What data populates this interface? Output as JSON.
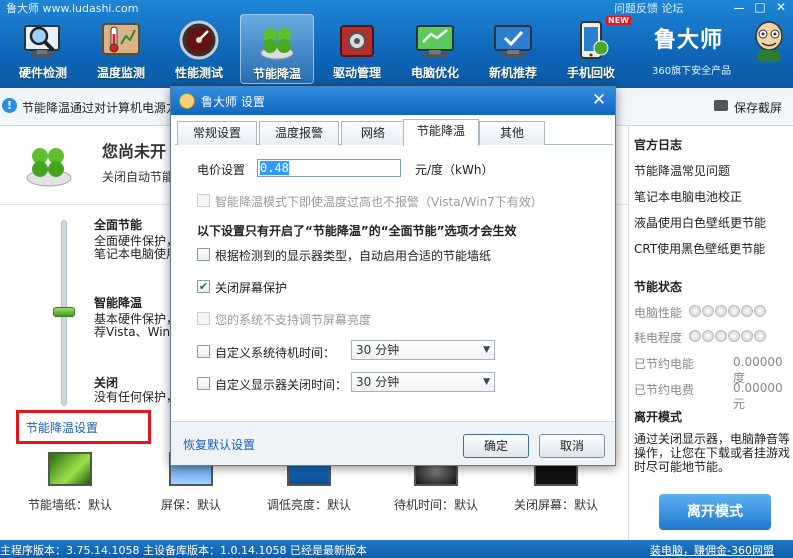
{
  "app": {
    "title": "鲁大师 www.ludashi.com",
    "top_links": "问题反馈  论坛",
    "window_controls": [
      "ー",
      "□",
      "✕"
    ],
    "brand_name": "鲁大师",
    "brand_sub": "360旗下安全产品",
    "accent_color": "#1472c6",
    "highlight_color": "#e8141b"
  },
  "toolbar": {
    "items": [
      {
        "label": "硬件检测",
        "icon": "magnifier-monitor-icon",
        "active": false
      },
      {
        "label": "温度监测",
        "icon": "thermometer-icon",
        "active": false
      },
      {
        "label": "性能测试",
        "icon": "gauge-icon",
        "active": false
      },
      {
        "label": "节能降温",
        "icon": "clover-icon",
        "active": true
      },
      {
        "label": "驱动管理",
        "icon": "driver-box-icon",
        "active": false
      },
      {
        "label": "电脑优化",
        "icon": "optimize-monitor-icon",
        "active": false
      },
      {
        "label": "新机推荐",
        "icon": "new-pc-icon",
        "active": false
      },
      {
        "label": "手机回收",
        "icon": "phone-recycle-icon",
        "active": false,
        "badge": "NEW"
      }
    ]
  },
  "infobar": {
    "message": "节能降温通过对计算机电源方",
    "save_screenshot": "保存截屏"
  },
  "main": {
    "status_title": "您尚未开",
    "status_desc": "关闭自动节能",
    "levels": [
      {
        "title": "全面节能",
        "desc_lines": [
          "全面硬件保护，",
          "笔记本电脑使用"
        ]
      },
      {
        "title": "智能降温",
        "desc_lines": [
          "基本硬件保护，",
          "荐Vista、Wind"
        ]
      },
      {
        "title": "关闭",
        "desc_lines": [
          "没有任何保护，"
        ]
      }
    ],
    "slider_level": "智能降温",
    "settings_link": "节能降温设置",
    "bottom_items": [
      {
        "label": "节能墙纸：默认",
        "icon": "wallpaper-thumb-icon"
      },
      {
        "label": "屏保：默认",
        "icon": "screensaver-thumb-icon"
      },
      {
        "label": "调低亮度：默认",
        "icon": "brightness-thumb-icon"
      },
      {
        "label": "待机时间：默认",
        "icon": "standby-thumb-icon"
      },
      {
        "label": "关闭屏幕：默认",
        "icon": "screen-off-thumb-icon"
      }
    ]
  },
  "sidebar": {
    "log_title": "官方日志",
    "log_links": [
      "节能降温常见问题",
      "笔记本电脑电池校正",
      "液晶使用白色壁纸更节能",
      "CRT使用黑色壁纸更节能"
    ],
    "status_title": "节能状态",
    "perf_label": "电脑性能",
    "power_label": "耗电程度",
    "rating_dots": 5,
    "saved_power_label": "已节约电能",
    "saved_power_value": "0.00000度",
    "saved_cost_label": "已节约电费",
    "saved_cost_value": "0.00000元",
    "away_title": "离开模式",
    "away_desc": "通过关闭显示器，电脑静音等操作，让您在下载或者挂游戏时尽可能地节能。",
    "away_button": "离开模式"
  },
  "statusbar": {
    "left": "主程序版本：3.75.14.1058  主设备库版本：1.0.14.1058  已经是最新版本",
    "right": "装电脑，赚佣金-360网盟"
  },
  "dialog": {
    "title": "鲁大师 设置",
    "close": "✕",
    "tabs": [
      {
        "label": "常规设置",
        "active": false
      },
      {
        "label": "温度报警",
        "active": false
      },
      {
        "label": "网络",
        "active": false
      },
      {
        "label": "节能降温",
        "active": true
      },
      {
        "label": "其他",
        "active": false
      }
    ],
    "price_label": "电价设置",
    "price_value": "0.48",
    "price_unit": "元/度（kWh）",
    "no_alarm_option": {
      "label": "智能降温模式下即使温度过高也不报警（Vista/Win7下有效）",
      "checked": false,
      "disabled": true
    },
    "notice": "以下设置只有开启了“节能降温”的“全面节能”选项才会生效",
    "auto_wallpaper_option": {
      "label": "根据检测到的显示器类型，自动启用合适的节能墙纸",
      "checked": false,
      "disabled": false
    },
    "screensaver_option": {
      "label": "关闭屏幕保护",
      "checked": true,
      "disabled": false
    },
    "brightness_option": {
      "label": "您的系统不支持调节屏幕亮度",
      "checked": false,
      "disabled": true
    },
    "standby_option": {
      "label": "自定义系统待机时间：",
      "checked": false,
      "value": "30 分钟"
    },
    "monitor_off_option": {
      "label": "自定义显示器关闭时间：",
      "checked": false,
      "value": "30 分钟"
    },
    "restore_defaults": "恢复默认设置",
    "ok": "确定",
    "cancel": "取消"
  }
}
